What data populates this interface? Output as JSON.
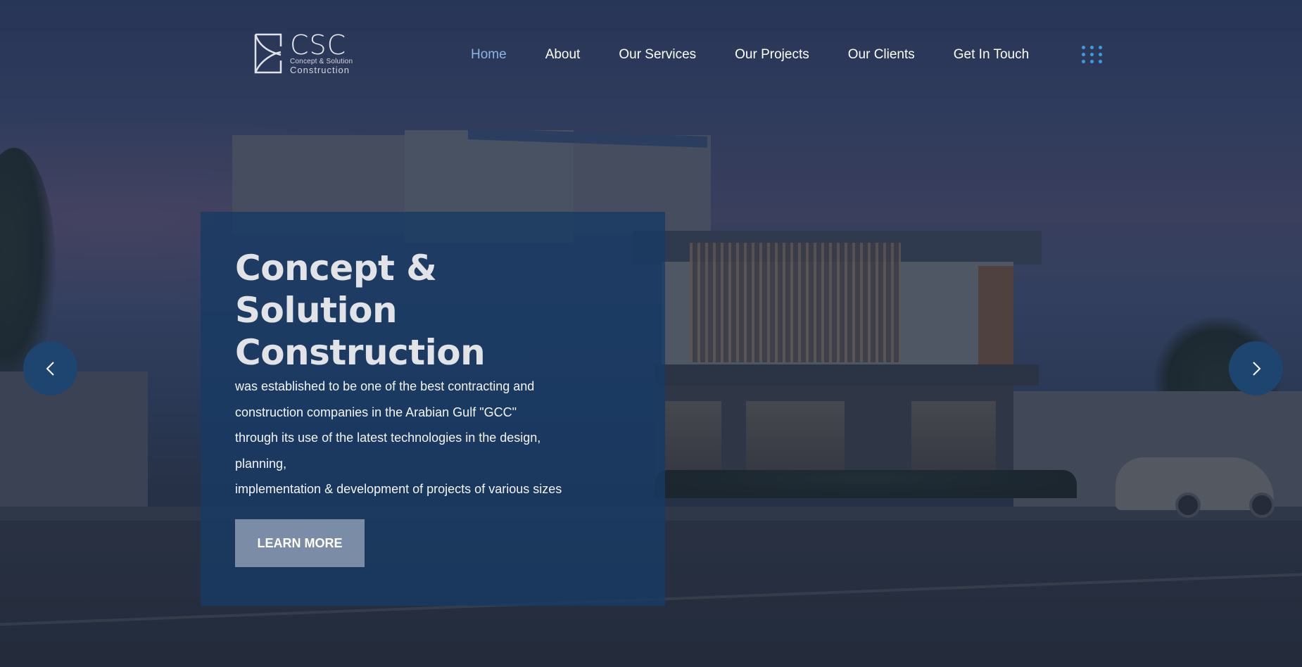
{
  "brand": {
    "logo_title": "CSC",
    "logo_subtitle_1": "Concept & Solution",
    "logo_subtitle_2": "Construction"
  },
  "nav": {
    "items": [
      {
        "label": "Home",
        "active": true
      },
      {
        "label": "About",
        "active": false
      },
      {
        "label": "Our Services",
        "active": false
      },
      {
        "label": "Our Projects",
        "active": false
      },
      {
        "label": "Our Clients",
        "active": false
      },
      {
        "label": "Get In Touch",
        "active": false
      }
    ],
    "menu_icon": "grid-dots-icon"
  },
  "hero": {
    "title_lines": [
      "Concept &",
      "Solution",
      "Construction"
    ],
    "description_lines": [
      "was established to be one of the best contracting and",
      "construction companies in the Arabian Gulf \"GCC\"",
      "through its use of the latest technologies in the design,",
      "planning,",
      "implementation & development of projects of various sizes"
    ],
    "cta_label": "LEARN MORE"
  },
  "carousel": {
    "prev_icon": "chevron-left-icon",
    "next_icon": "chevron-right-icon"
  },
  "colors": {
    "accent_nav_active": "#8ab6e6",
    "grid_icon": "#3d9be0",
    "card_bg": "#183a64",
    "cta_bg": "#7a8ca6",
    "arrow_bg": "#1e4470"
  }
}
